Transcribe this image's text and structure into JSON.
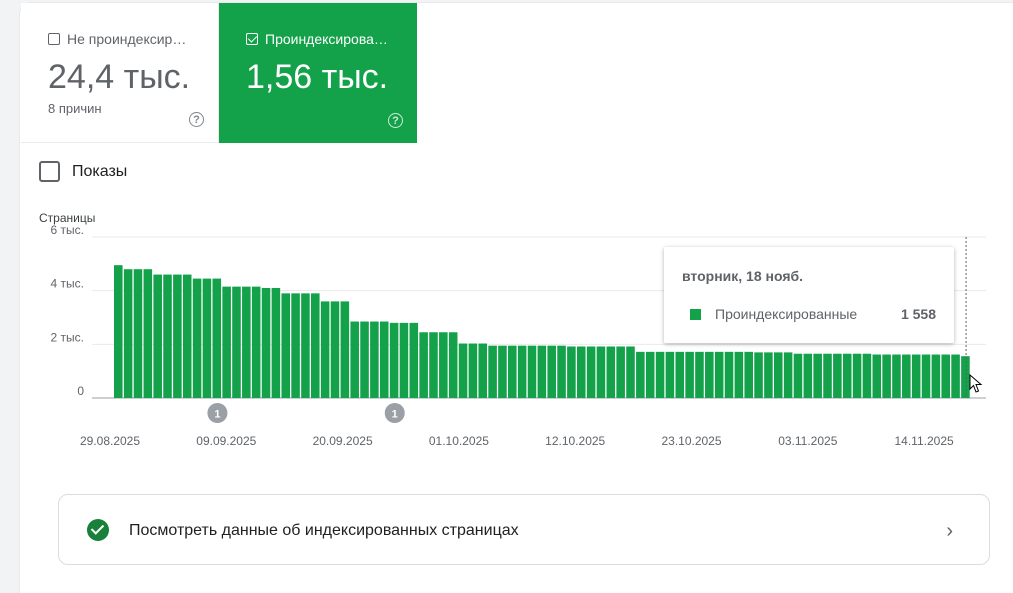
{
  "tiles": {
    "not_indexed": {
      "label": "Не проиндексир…",
      "value": "24,4 тыс.",
      "sub": "8 причин",
      "checked": false
    },
    "indexed": {
      "label": "Проиндексирова…",
      "value": "1,56 тыс.",
      "checked": true
    }
  },
  "impressions_label": "Показы",
  "chart_data": {
    "type": "bar",
    "ylabel": "Страницы",
    "ylim": [
      0,
      6000
    ],
    "y_ticks": [
      {
        "value": 0,
        "label": "0"
      },
      {
        "value": 2000,
        "label": "2 тыс."
      },
      {
        "value": 4000,
        "label": "4 тыс."
      },
      {
        "value": 6000,
        "label": "6 тыс."
      }
    ],
    "x_ticks": [
      "29.08.2025",
      "09.09.2025",
      "20.09.2025",
      "01.10.2025",
      "12.10.2025",
      "23.10.2025",
      "03.11.2025",
      "14.11.2025"
    ],
    "series": [
      {
        "name": "Проиндексированные",
        "color": "#13a14a",
        "values": [
          4950,
          4800,
          4800,
          4800,
          4600,
          4600,
          4600,
          4600,
          4450,
          4450,
          4450,
          4150,
          4150,
          4150,
          4150,
          4100,
          4100,
          3900,
          3900,
          3900,
          3900,
          3600,
          3600,
          3600,
          2850,
          2850,
          2850,
          2850,
          2800,
          2800,
          2800,
          2450,
          2450,
          2450,
          2450,
          2030,
          2030,
          2030,
          1950,
          1950,
          1950,
          1950,
          1950,
          1950,
          1950,
          1950,
          1920,
          1920,
          1920,
          1920,
          1920,
          1920,
          1920,
          1720,
          1720,
          1720,
          1720,
          1720,
          1720,
          1720,
          1720,
          1720,
          1720,
          1720,
          1720,
          1700,
          1700,
          1700,
          1700,
          1650,
          1650,
          1650,
          1650,
          1650,
          1650,
          1650,
          1650,
          1620,
          1620,
          1620,
          1620,
          1620,
          1620,
          1620,
          1620,
          1620,
          1558
        ]
      }
    ],
    "annotations": [
      {
        "label": "1",
        "index": 10
      },
      {
        "label": "1",
        "index": 28
      }
    ]
  },
  "tooltip": {
    "date": "вторник, 18 нояб.",
    "series": "Проиндексированные",
    "value": "1 558"
  },
  "link_card": {
    "text": "Посмотреть данные об индексированных страницах",
    "chevron": "›"
  }
}
